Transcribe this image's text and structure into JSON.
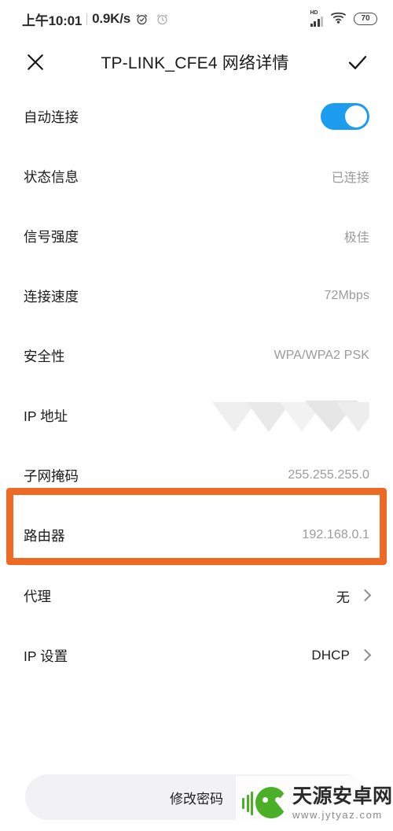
{
  "status_bar": {
    "time": "上午10:01",
    "network_speed": "0.9K/s",
    "alarm_icon": "alarm-clock-icon",
    "alarm_icon_secondary": "alarm-clock-icon",
    "hd_label": "HD",
    "signal_icon": "cellular-signal-icon",
    "wifi_icon": "wifi-icon",
    "battery_level": "70"
  },
  "header": {
    "close_icon": "close-icon",
    "title": "TP-LINK_CFE4 网络详情",
    "confirm_icon": "check-icon"
  },
  "rows": [
    {
      "label": "自动连接",
      "value": "",
      "type": "toggle",
      "toggle_on": true
    },
    {
      "label": "状态信息",
      "value": "已连接",
      "type": "value"
    },
    {
      "label": "信号强度",
      "value": "极佳",
      "type": "value"
    },
    {
      "label": "连接速度",
      "value": "72Mbps",
      "type": "value"
    },
    {
      "label": "安全性",
      "value": "WPA/WPA2 PSK",
      "type": "value"
    },
    {
      "label": "IP 地址",
      "value": "",
      "type": "masked"
    },
    {
      "label": "子网掩码",
      "value": "255.255.255.0",
      "type": "value"
    },
    {
      "label": "路由器",
      "value": "192.168.0.1",
      "type": "value",
      "highlighted": true
    }
  ],
  "settings_rows": [
    {
      "label": "代理",
      "value": "无",
      "chevron_icon": "chevron-right-icon"
    },
    {
      "label": "IP 设置",
      "value": "DHCP",
      "chevron_icon": "chevron-right-icon"
    }
  ],
  "bottom": {
    "change_password_label": "修改密码"
  },
  "watermark": {
    "site_name": "天源安卓网",
    "site_url": "www.jytyaz.com",
    "logo_icon": "android-robot-icon"
  },
  "colors": {
    "accent_toggle": "#1c9cef",
    "highlight_box": "#ec6a23",
    "watermark_green": "#4caf28",
    "value_gray": "#9b9b9b"
  }
}
